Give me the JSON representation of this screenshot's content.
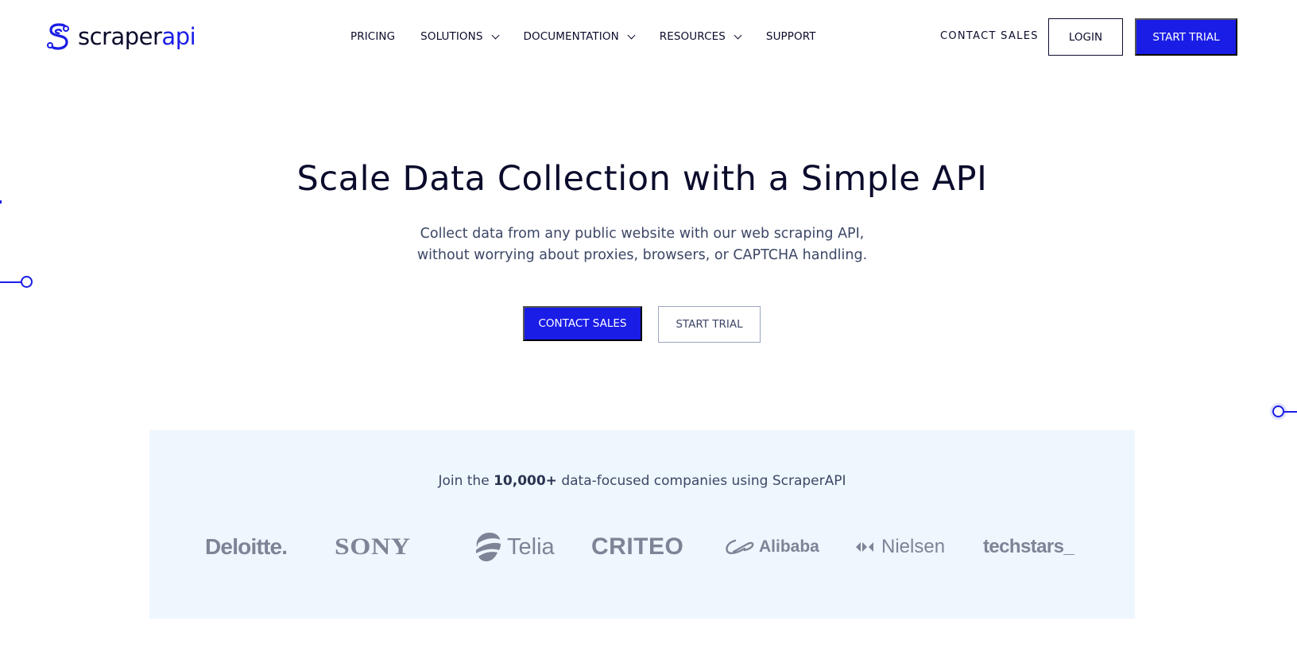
{
  "brand": {
    "name_part1": "scraper",
    "name_part2": "api",
    "primary_color": "#1a1de6",
    "text_color": "#0b0c2c",
    "panel_bg": "#eef6fe"
  },
  "nav": {
    "items": [
      {
        "label": "PRICING",
        "has_dropdown": false
      },
      {
        "label": "SOLUTIONS",
        "has_dropdown": true
      },
      {
        "label": "DOCUMENTATION",
        "has_dropdown": true
      },
      {
        "label": "RESOURCES",
        "has_dropdown": true
      },
      {
        "label": "SUPPORT",
        "has_dropdown": false
      }
    ],
    "contact_sales": "CONTACT SALES",
    "login": "LOGIN",
    "start_trial": "START TRIAL"
  },
  "hero": {
    "title": "Scale Data Collection with a Simple API",
    "subtitle_line1": "Collect data from any public website with our web scraping API,",
    "subtitle_line2": "without worrying about proxies, browsers, or CAPTCHA handling.",
    "primary_cta": "CONTACT SALES",
    "secondary_cta": "START TRIAL"
  },
  "social_proof": {
    "text_before": "Join the ",
    "highlight": "10,000+",
    "text_after": " data-focused companies using ScraperAPI",
    "logos": [
      {
        "name": "Deloitte.",
        "icon": "deloitte-logo"
      },
      {
        "name": "SONY",
        "icon": "sony-logo"
      },
      {
        "name": "Telia",
        "icon": "telia-logo"
      },
      {
        "name": "CRITEO",
        "icon": "criteo-logo"
      },
      {
        "name": "Alibaba",
        "icon": "alibaba-logo"
      },
      {
        "name": "Nielsen",
        "icon": "nielsen-logo"
      },
      {
        "name": "techstars_",
        "icon": "techstars-logo"
      }
    ]
  }
}
